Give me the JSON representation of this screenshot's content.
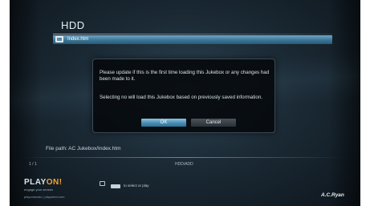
{
  "screen": {
    "title": "HDD"
  },
  "list": {
    "selected_item": "Index.htm"
  },
  "dialog": {
    "message1": "Please update if this is the first time loading this Jukebox or any changes had been made to it.",
    "message2": "Selecting no will load this Jukebox based on previously saved information.",
    "ok_label": "OK",
    "cancel_label": "Cancel"
  },
  "footer": {
    "file_path": "File path: AC Jukebox/Index.htm",
    "counter": "1 / 1",
    "storage": "HDD/ADD",
    "logo_text_main": "PLAY",
    "logo_text_accent": "ON!",
    "logo_tagline": "engage your senses",
    "logo_url": "playonmusic | playonhd.com",
    "hint": "to select or play",
    "brand": "A.C.Ryan"
  },
  "icons": [
    "folder-icon",
    "screen-icon",
    "key-icon"
  ],
  "colors": {
    "selection": "#3c7596",
    "ok_button": "#4a8db3",
    "accent": "#f2a33a"
  }
}
